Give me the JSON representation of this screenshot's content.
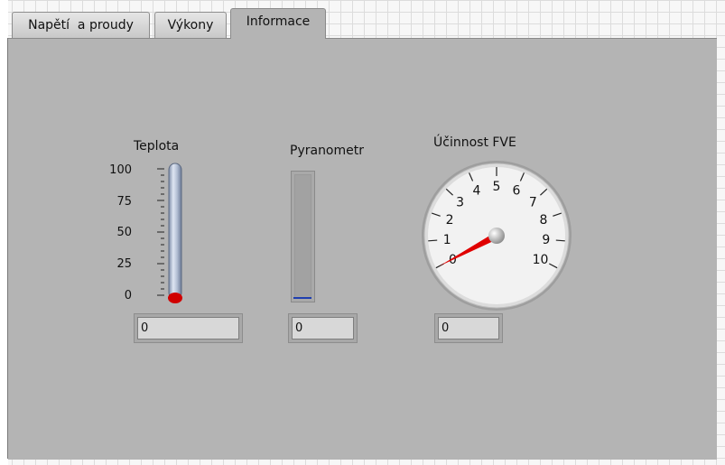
{
  "tabs": [
    {
      "label": "Napětí  a proudy",
      "active": false
    },
    {
      "label": "Výkony",
      "active": false
    },
    {
      "label": "Informace",
      "active": true
    }
  ],
  "teplota": {
    "label": "Teplota",
    "ticks": [
      "100",
      "75",
      "50",
      "25",
      "0"
    ],
    "value": "0",
    "level": 0,
    "scale": [
      0,
      100
    ],
    "fill_color": "#d00000"
  },
  "pyranometr": {
    "label": "Pyranometr",
    "value": "0",
    "level": 0,
    "bar_color": "#1f3fb0"
  },
  "ucinnost": {
    "label": "Účinnost FVE",
    "ticks": [
      "0",
      "1",
      "2",
      "3",
      "4",
      "5",
      "6",
      "7",
      "8",
      "9",
      "10"
    ],
    "value": "0",
    "needle_value": 0,
    "scale": [
      0,
      10
    ],
    "needle_color": "#e00000"
  }
}
